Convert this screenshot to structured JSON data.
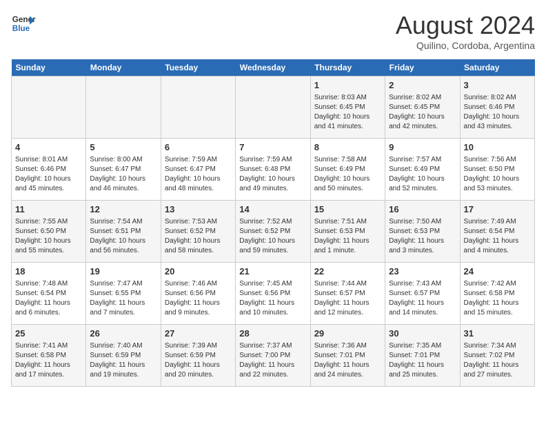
{
  "header": {
    "logo_line1": "General",
    "logo_line2": "Blue",
    "month_year": "August 2024",
    "location": "Quilino, Cordoba, Argentina"
  },
  "days_of_week": [
    "Sunday",
    "Monday",
    "Tuesday",
    "Wednesday",
    "Thursday",
    "Friday",
    "Saturday"
  ],
  "weeks": [
    [
      {
        "day": "",
        "detail": ""
      },
      {
        "day": "",
        "detail": ""
      },
      {
        "day": "",
        "detail": ""
      },
      {
        "day": "",
        "detail": ""
      },
      {
        "day": "1",
        "detail": "Sunrise: 8:03 AM\nSunset: 6:45 PM\nDaylight: 10 hours\nand 41 minutes."
      },
      {
        "day": "2",
        "detail": "Sunrise: 8:02 AM\nSunset: 6:45 PM\nDaylight: 10 hours\nand 42 minutes."
      },
      {
        "day": "3",
        "detail": "Sunrise: 8:02 AM\nSunset: 6:46 PM\nDaylight: 10 hours\nand 43 minutes."
      }
    ],
    [
      {
        "day": "4",
        "detail": "Sunrise: 8:01 AM\nSunset: 6:46 PM\nDaylight: 10 hours\nand 45 minutes."
      },
      {
        "day": "5",
        "detail": "Sunrise: 8:00 AM\nSunset: 6:47 PM\nDaylight: 10 hours\nand 46 minutes."
      },
      {
        "day": "6",
        "detail": "Sunrise: 7:59 AM\nSunset: 6:47 PM\nDaylight: 10 hours\nand 48 minutes."
      },
      {
        "day": "7",
        "detail": "Sunrise: 7:59 AM\nSunset: 6:48 PM\nDaylight: 10 hours\nand 49 minutes."
      },
      {
        "day": "8",
        "detail": "Sunrise: 7:58 AM\nSunset: 6:49 PM\nDaylight: 10 hours\nand 50 minutes."
      },
      {
        "day": "9",
        "detail": "Sunrise: 7:57 AM\nSunset: 6:49 PM\nDaylight: 10 hours\nand 52 minutes."
      },
      {
        "day": "10",
        "detail": "Sunrise: 7:56 AM\nSunset: 6:50 PM\nDaylight: 10 hours\nand 53 minutes."
      }
    ],
    [
      {
        "day": "11",
        "detail": "Sunrise: 7:55 AM\nSunset: 6:50 PM\nDaylight: 10 hours\nand 55 minutes."
      },
      {
        "day": "12",
        "detail": "Sunrise: 7:54 AM\nSunset: 6:51 PM\nDaylight: 10 hours\nand 56 minutes."
      },
      {
        "day": "13",
        "detail": "Sunrise: 7:53 AM\nSunset: 6:52 PM\nDaylight: 10 hours\nand 58 minutes."
      },
      {
        "day": "14",
        "detail": "Sunrise: 7:52 AM\nSunset: 6:52 PM\nDaylight: 10 hours\nand 59 minutes."
      },
      {
        "day": "15",
        "detail": "Sunrise: 7:51 AM\nSunset: 6:53 PM\nDaylight: 11 hours\nand 1 minute."
      },
      {
        "day": "16",
        "detail": "Sunrise: 7:50 AM\nSunset: 6:53 PM\nDaylight: 11 hours\nand 3 minutes."
      },
      {
        "day": "17",
        "detail": "Sunrise: 7:49 AM\nSunset: 6:54 PM\nDaylight: 11 hours\nand 4 minutes."
      }
    ],
    [
      {
        "day": "18",
        "detail": "Sunrise: 7:48 AM\nSunset: 6:54 PM\nDaylight: 11 hours\nand 6 minutes."
      },
      {
        "day": "19",
        "detail": "Sunrise: 7:47 AM\nSunset: 6:55 PM\nDaylight: 11 hours\nand 7 minutes."
      },
      {
        "day": "20",
        "detail": "Sunrise: 7:46 AM\nSunset: 6:56 PM\nDaylight: 11 hours\nand 9 minutes."
      },
      {
        "day": "21",
        "detail": "Sunrise: 7:45 AM\nSunset: 6:56 PM\nDaylight: 11 hours\nand 10 minutes."
      },
      {
        "day": "22",
        "detail": "Sunrise: 7:44 AM\nSunset: 6:57 PM\nDaylight: 11 hours\nand 12 minutes."
      },
      {
        "day": "23",
        "detail": "Sunrise: 7:43 AM\nSunset: 6:57 PM\nDaylight: 11 hours\nand 14 minutes."
      },
      {
        "day": "24",
        "detail": "Sunrise: 7:42 AM\nSunset: 6:58 PM\nDaylight: 11 hours\nand 15 minutes."
      }
    ],
    [
      {
        "day": "25",
        "detail": "Sunrise: 7:41 AM\nSunset: 6:58 PM\nDaylight: 11 hours\nand 17 minutes."
      },
      {
        "day": "26",
        "detail": "Sunrise: 7:40 AM\nSunset: 6:59 PM\nDaylight: 11 hours\nand 19 minutes."
      },
      {
        "day": "27",
        "detail": "Sunrise: 7:39 AM\nSunset: 6:59 PM\nDaylight: 11 hours\nand 20 minutes."
      },
      {
        "day": "28",
        "detail": "Sunrise: 7:37 AM\nSunset: 7:00 PM\nDaylight: 11 hours\nand 22 minutes."
      },
      {
        "day": "29",
        "detail": "Sunrise: 7:36 AM\nSunset: 7:01 PM\nDaylight: 11 hours\nand 24 minutes."
      },
      {
        "day": "30",
        "detail": "Sunrise: 7:35 AM\nSunset: 7:01 PM\nDaylight: 11 hours\nand 25 minutes."
      },
      {
        "day": "31",
        "detail": "Sunrise: 7:34 AM\nSunset: 7:02 PM\nDaylight: 11 hours\nand 27 minutes."
      }
    ]
  ]
}
